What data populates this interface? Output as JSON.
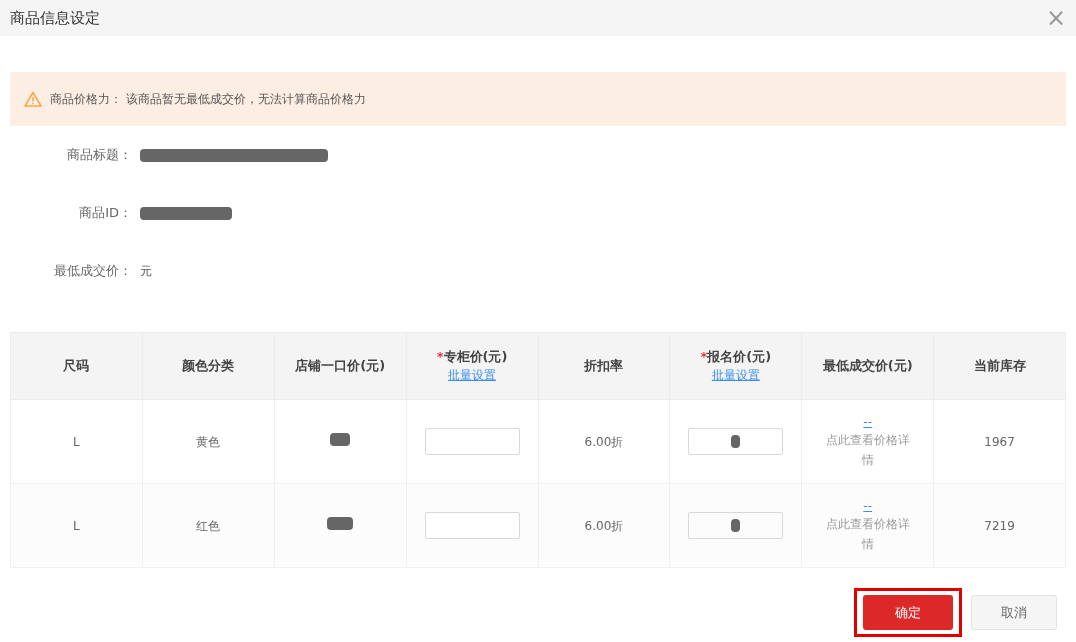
{
  "window": {
    "title": "商品信息设定",
    "close": "×"
  },
  "alert": {
    "label": "商品价格力：",
    "message": "该商品暂无最低成交价，无法计算商品价格力"
  },
  "fields": [
    {
      "label": "商品标题：",
      "kind": "redacted-long"
    },
    {
      "label": "商品ID：",
      "kind": "redacted-short"
    },
    {
      "label": "最低成交价：",
      "kind": "text",
      "value": "元"
    }
  ],
  "table": {
    "columns": [
      {
        "label": "尺码"
      },
      {
        "label": "颜色分类"
      },
      {
        "label": "店铺一口价(元)"
      },
      {
        "label": "专柜价(元)",
        "marker": "*",
        "link": "批量设置"
      },
      {
        "label": "折扣率"
      },
      {
        "label": "报名价(元)",
        "marker": "*",
        "link": "批量设置"
      },
      {
        "label": "最低成交价(元)"
      },
      {
        "label": "当前库存"
      }
    ],
    "rows": [
      {
        "cells": [
          {
            "kind": "text",
            "text": "L"
          },
          {
            "kind": "text",
            "text": "黄色"
          },
          {
            "kind": "redacted"
          },
          {
            "kind": "input"
          },
          {
            "kind": "text",
            "text": "6.00折"
          },
          {
            "kind": "redacted-input"
          },
          {
            "kind": "link",
            "link": "--",
            "text": "点此查看价格详情"
          },
          {
            "kind": "text",
            "text": "1967"
          }
        ]
      },
      {
        "cells": [
          {
            "kind": "text",
            "text": "L"
          },
          {
            "kind": "text",
            "text": "红色"
          },
          {
            "kind": "redacted"
          },
          {
            "kind": "input"
          },
          {
            "kind": "text",
            "text": "6.00折"
          },
          {
            "kind": "redacted-input"
          },
          {
            "kind": "link",
            "link": "--",
            "text": "点此查看价格详情"
          },
          {
            "kind": "text",
            "text": "7219"
          }
        ]
      }
    ]
  },
  "buttons": [
    {
      "label": "确定",
      "kind": "primary",
      "highlighted": true
    },
    {
      "label": "取消",
      "kind": "secondary",
      "highlighted": false
    }
  ]
}
